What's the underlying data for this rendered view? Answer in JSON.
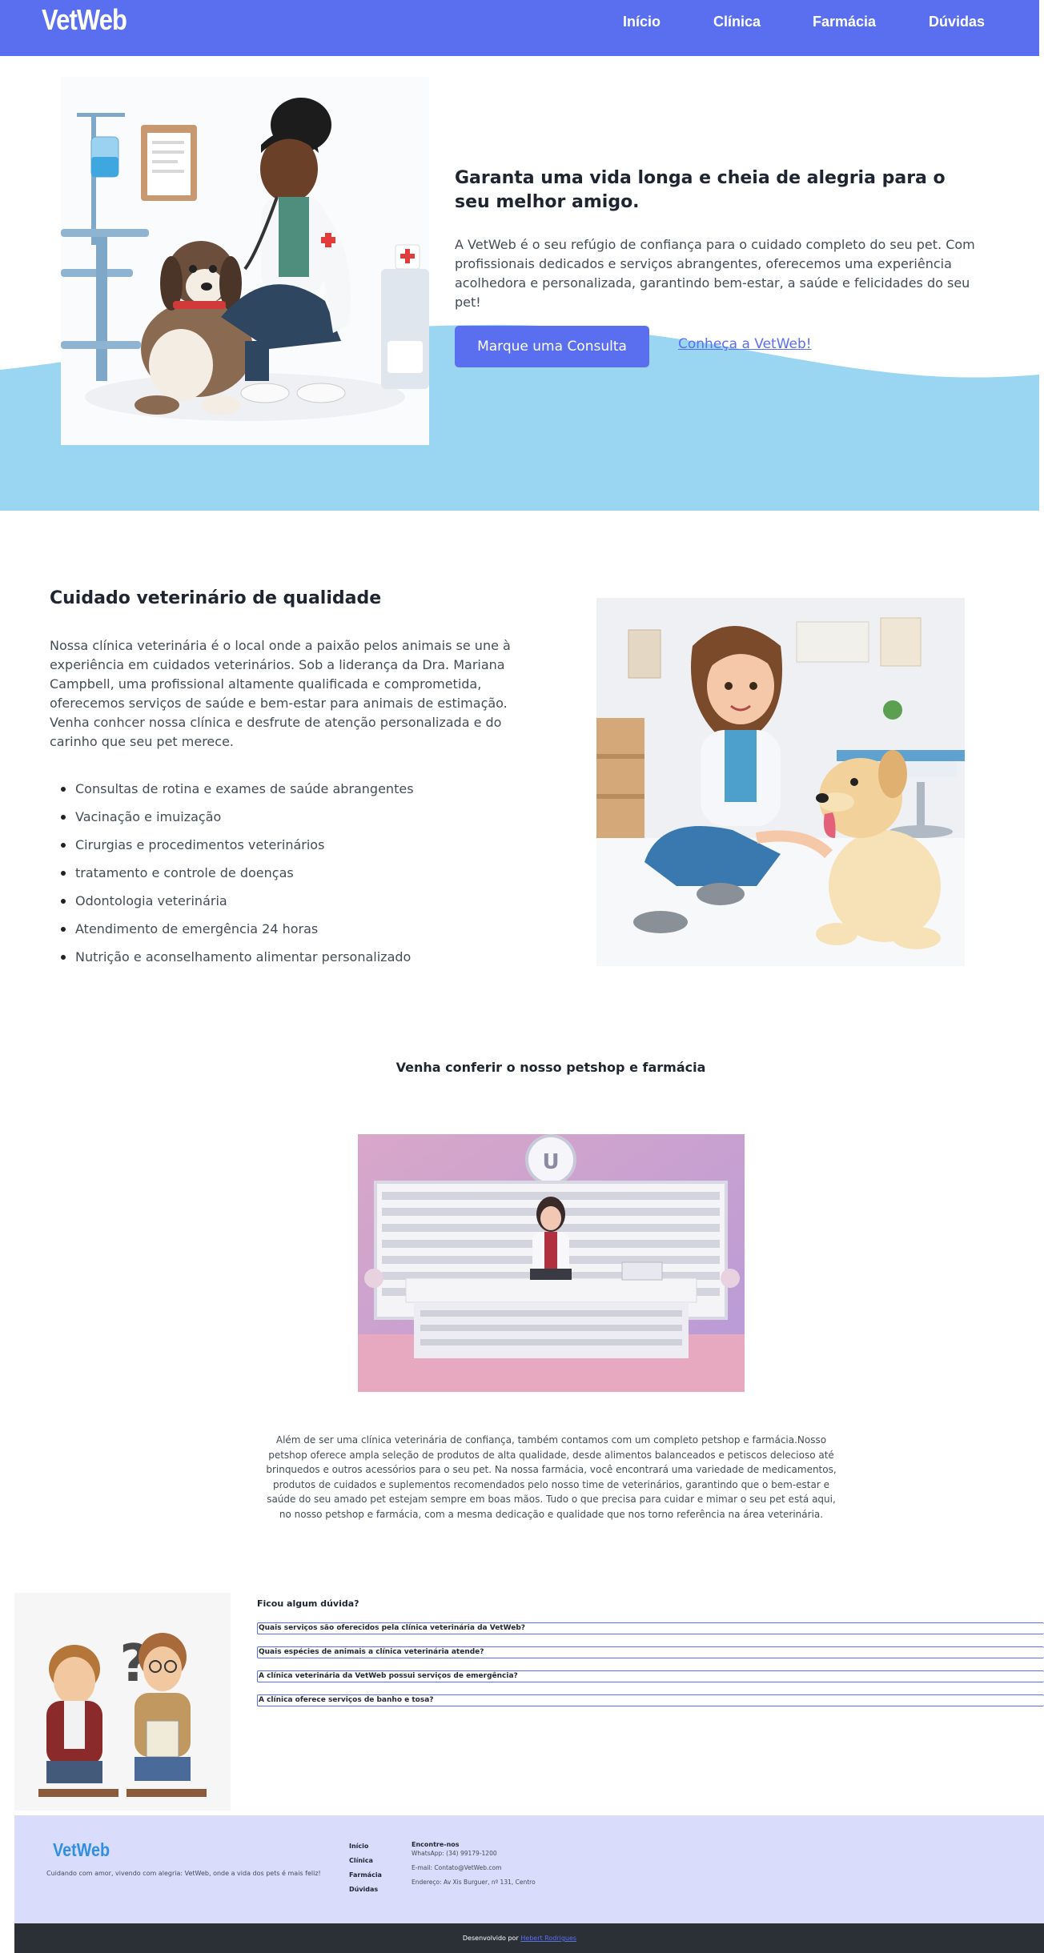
{
  "brand": {
    "logo": "VetWeb",
    "primary_color": "#5a6ef0",
    "wave_color": "#9ad5f2"
  },
  "nav": {
    "items": [
      "Início",
      "Clínica",
      "Farmácia",
      "Dúvidas"
    ]
  },
  "hero": {
    "title": "Garanta uma vida longa e cheia de alegria para o seu melhor amigo.",
    "text": "A VetWeb é o seu refúgio de confiança para o cuidado completo do seu pet. Com profissionais dedicados e serviços abrangentes, oferecemos uma experiência acolhedora e personalizada, garantindo bem-estar, a saúde e felicidades do seu pet!",
    "cta_button": "Marque uma Consulta",
    "cta_link": "Conheça a VetWeb!"
  },
  "clinic": {
    "title": "Cuidado veterinário de qualidade",
    "text": "Nossa clínica veterinária é o local onde a paixão pelos animais se une à experiência em cuidados veterinários. Sob a liderança da Dra. Mariana Campbell, uma profissional altamente qualificada e comprometida, oferecemos serviços de saúde e bem-estar para animais de estimação. Venha conhcer nossa clínica e desfrute de atenção personalizada e do carinho que seu pet merece.",
    "services": [
      "Consultas de rotina e exames de saúde abrangentes",
      "Vacinação e imuização",
      "Cirurgias e procedimentos veterinários",
      "tratamento e controle de doenças",
      "Odontologia veterinária",
      "Atendimento de emergência 24 horas",
      "Nutrição e aconselhamento alimentar personalizado"
    ]
  },
  "shop": {
    "title": "Venha conferir o nosso petshop e farmácia",
    "text": "Além de ser uma clínica veterinária de confiança, também contamos com um completo petshop e farmácia.Nosso petshop oferece ampla seleção de produtos de alta qualidade, desde alimentos balanceados e petiscos delecioso até brinquedos e outros acessórios para o seu pet. Na nossa farmácia, você encontrará uma variedade de medicamentos, produtos de cuidados e suplementos recomendados pelo nosso time de veterinários, garantindo que o bem-estar e saúde do seu amado pet estejam sempre em boas mãos. Tudo o que precisa para cuidar e mimar o seu pet está aqui, no nosso petshop e farmácia, com a mesma dedicação e qualidade que nos torno referência na área veterinária."
  },
  "faq": {
    "title": "Ficou algum dúvida?",
    "questions": [
      "Quais serviços são oferecidos pela clínica veterinária da VetWeb?",
      "Quais espécies de animais a clínica veterinária atende?",
      "A clínica veterinária da VetWeb possui serviços de emergência?",
      "A clínica oferece serviços de banho e tosa?"
    ]
  },
  "footer": {
    "logo": "VetWeb",
    "logo_color": "#2f8fe0",
    "tagline": "Cuidando com amor, vivendo com alegria: VetWeb, onde a vida dos pets é mais feliz!",
    "nav": [
      "Início",
      "Clínica",
      "Farmácia",
      "Dúvidas"
    ],
    "contact_title": "Encontre-nos",
    "whatsapp": "WhatsApp: (34) 99179-1200",
    "email": "E-mail: Contato@VetWeb.com",
    "address": "Endereço: Av Xis Burguer, nº 131, Centro",
    "developed_by": "Desenvolvido por",
    "developer": "Hebert Rodrigues"
  }
}
